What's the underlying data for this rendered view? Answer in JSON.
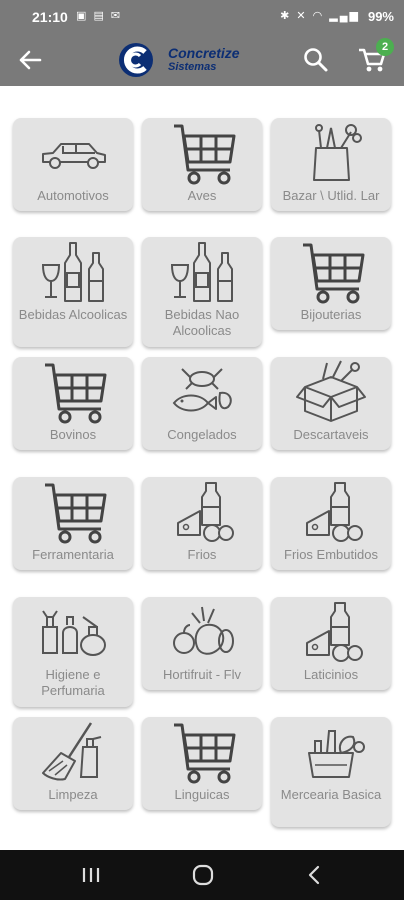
{
  "status": {
    "time": "21:10",
    "left_icons": "▣ ▤ ✉",
    "right_icons": "✱ ✕ ◠ ▂▄▆",
    "battery": "99%"
  },
  "header": {
    "brand_title": "Concretize",
    "brand_sub": "Sistemas",
    "cart_count": "2"
  },
  "colors": {
    "bar": "#7a7a7a",
    "tile": "#e3e3e3",
    "label": "#8a8a8a",
    "badge": "#4caf50"
  },
  "categories": [
    {
      "label": "Automotivos",
      "icon": "car-icon"
    },
    {
      "label": "Aves",
      "icon": "cart-icon"
    },
    {
      "label": "Bazar \\ Utlid. Lar",
      "icon": "grocery-bag-icon"
    },
    {
      "label": "Bebidas Alcoolicas",
      "icon": "bottles-icon"
    },
    {
      "label": "Bebidas Nao Alcoolicas",
      "icon": "bottles-icon"
    },
    {
      "label": "Bijouterias",
      "icon": "cart-icon"
    },
    {
      "label": "Bovinos",
      "icon": "cart-icon"
    },
    {
      "label": "Congelados",
      "icon": "seafood-icon"
    },
    {
      "label": "Descartaveis",
      "icon": "box-icon"
    },
    {
      "label": "Ferramentaria",
      "icon": "cart-icon"
    },
    {
      "label": "Frios",
      "icon": "dairy-icon"
    },
    {
      "label": "Frios Embutidos",
      "icon": "dairy-icon"
    },
    {
      "label": "Higiene e Perfumaria",
      "icon": "cleaning-products-icon"
    },
    {
      "label": "Hortifruit - Flv",
      "icon": "fruits-vegetables-icon"
    },
    {
      "label": "Laticinios",
      "icon": "dairy-icon"
    },
    {
      "label": "Limpeza",
      "icon": "broom-icon"
    },
    {
      "label": "Linguicas",
      "icon": "cart-icon"
    },
    {
      "label": "Mercearia Basica",
      "icon": "pantry-icon"
    }
  ]
}
